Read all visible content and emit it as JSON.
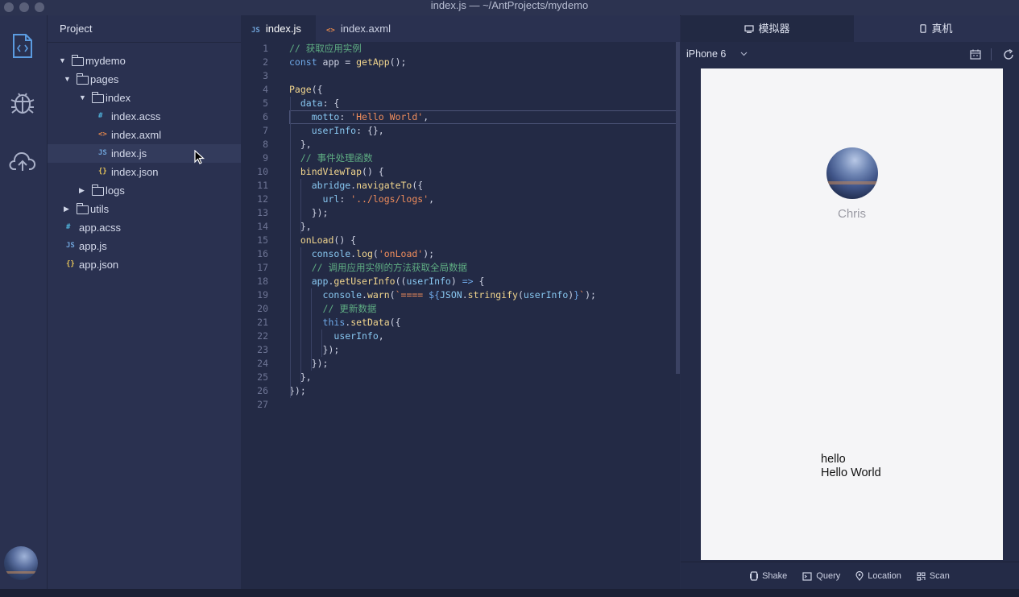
{
  "window": {
    "title": "index.js — ~/AntProjects/mydemo"
  },
  "activity_bar": {
    "icons": [
      "code-file-icon",
      "bug-icon",
      "cloud-upload-icon"
    ]
  },
  "sidebar": {
    "header": "Project",
    "tree": [
      {
        "label": "mydemo",
        "type": "folder",
        "expanded": true,
        "depth": 0
      },
      {
        "label": "pages",
        "type": "folder",
        "expanded": true,
        "depth": 1
      },
      {
        "label": "index",
        "type": "folder",
        "expanded": true,
        "depth": 2
      },
      {
        "label": "index.acss",
        "type": "acss",
        "depth": 3
      },
      {
        "label": "index.axml",
        "type": "axml",
        "depth": 3
      },
      {
        "label": "index.js",
        "type": "js",
        "depth": 3,
        "selected": true
      },
      {
        "label": "index.json",
        "type": "json",
        "depth": 3
      },
      {
        "label": "logs",
        "type": "folder",
        "expanded": false,
        "depth": 2
      },
      {
        "label": "utils",
        "type": "folder",
        "expanded": false,
        "depth": 1
      },
      {
        "label": "app.acss",
        "type": "acss",
        "depth": 1
      },
      {
        "label": "app.js",
        "type": "js",
        "depth": 1
      },
      {
        "label": "app.json",
        "type": "json",
        "depth": 1
      }
    ],
    "file_icon_glyphs": {
      "acss": "#",
      "axml": "<>",
      "js": "JS",
      "json": "{}"
    },
    "file_icon_colors": {
      "acss": "#4fb0d8",
      "axml": "#e4884d",
      "js": "#6fa3d9",
      "json": "#e6c45a"
    }
  },
  "editor": {
    "tabs": [
      {
        "label": "index.js",
        "icon": "JS",
        "active": true
      },
      {
        "label": "index.axml",
        "icon": "<>",
        "active": false
      }
    ],
    "current_line": 6,
    "lines": [
      [
        [
          "cm",
          "// 获取应用实例"
        ]
      ],
      [
        [
          "kw",
          "const "
        ],
        [
          "pn",
          "app = "
        ],
        [
          "fn",
          "getApp"
        ],
        [
          "pn",
          "();"
        ]
      ],
      [],
      [
        [
          "fn",
          "Page"
        ],
        [
          "pn",
          "({"
        ]
      ],
      [
        [
          "pn",
          "  "
        ],
        [
          "prop",
          "data"
        ],
        [
          "pn",
          ": {"
        ]
      ],
      [
        [
          "pn",
          "    "
        ],
        [
          "prop",
          "motto"
        ],
        [
          "pn",
          ": "
        ],
        [
          "str",
          "'Hello World'"
        ],
        [
          "pn",
          ","
        ]
      ],
      [
        [
          "pn",
          "    "
        ],
        [
          "prop",
          "userInfo"
        ],
        [
          "pn",
          ": {},"
        ]
      ],
      [
        [
          "pn",
          "  },"
        ]
      ],
      [
        [
          "pn",
          "  "
        ],
        [
          "cm",
          "// 事件处理函数"
        ]
      ],
      [
        [
          "pn",
          "  "
        ],
        [
          "fn",
          "bindViewTap"
        ],
        [
          "pn",
          "() {"
        ]
      ],
      [
        [
          "pn",
          "    "
        ],
        [
          "prop",
          "abridge"
        ],
        [
          "pn",
          "."
        ],
        [
          "fn",
          "navigateTo"
        ],
        [
          "pn",
          "({"
        ]
      ],
      [
        [
          "pn",
          "      "
        ],
        [
          "prop",
          "url"
        ],
        [
          "pn",
          ": "
        ],
        [
          "str",
          "'../logs/logs'"
        ],
        [
          "pn",
          ","
        ]
      ],
      [
        [
          "pn",
          "    });"
        ]
      ],
      [
        [
          "pn",
          "  },"
        ]
      ],
      [
        [
          "pn",
          "  "
        ],
        [
          "fn",
          "onLoad"
        ],
        [
          "pn",
          "() {"
        ]
      ],
      [
        [
          "pn",
          "    "
        ],
        [
          "prop",
          "console"
        ],
        [
          "pn",
          "."
        ],
        [
          "fn",
          "log"
        ],
        [
          "pn",
          "("
        ],
        [
          "str",
          "'onLoad'"
        ],
        [
          "pn",
          ");"
        ]
      ],
      [
        [
          "pn",
          "    "
        ],
        [
          "cm",
          "// 调用应用实例的方法获取全局数据"
        ]
      ],
      [
        [
          "pn",
          "    "
        ],
        [
          "prop",
          "app"
        ],
        [
          "pn",
          "."
        ],
        [
          "fn",
          "getUserInfo"
        ],
        [
          "pn",
          "(("
        ],
        [
          "prop",
          "userInfo"
        ],
        [
          "pn",
          ") "
        ],
        [
          "kw",
          "=>"
        ],
        [
          "pn",
          " {"
        ]
      ],
      [
        [
          "pn",
          "      "
        ],
        [
          "prop",
          "console"
        ],
        [
          "pn",
          "."
        ],
        [
          "fn",
          "warn"
        ],
        [
          "pn",
          "("
        ],
        [
          "str",
          "`==== "
        ],
        [
          "kw",
          "${"
        ],
        [
          "prop",
          "JSON"
        ],
        [
          "pn",
          "."
        ],
        [
          "fn",
          "stringify"
        ],
        [
          "pn",
          "("
        ],
        [
          "prop",
          "userInfo"
        ],
        [
          "pn",
          ")"
        ],
        [
          "kw",
          "}"
        ],
        [
          "str",
          "`"
        ],
        [
          "pn",
          ");"
        ]
      ],
      [
        [
          "pn",
          "      "
        ],
        [
          "cm",
          "// 更新数据"
        ]
      ],
      [
        [
          "pn",
          "      "
        ],
        [
          "kw",
          "this"
        ],
        [
          "pn",
          "."
        ],
        [
          "fn",
          "setData"
        ],
        [
          "pn",
          "({"
        ]
      ],
      [
        [
          "pn",
          "        "
        ],
        [
          "prop",
          "userInfo"
        ],
        [
          "pn",
          ","
        ]
      ],
      [
        [
          "pn",
          "      });"
        ]
      ],
      [
        [
          "pn",
          "    });"
        ]
      ],
      [
        [
          "pn",
          "  },"
        ]
      ],
      [
        [
          "pn",
          "});"
        ]
      ],
      []
    ]
  },
  "preview": {
    "tabs": [
      {
        "label": "模拟器",
        "icon": "monitor-icon",
        "active": true
      },
      {
        "label": "真机",
        "icon": "phone-icon",
        "active": false
      }
    ],
    "device": "iPhone 6",
    "phone": {
      "name": "Chris",
      "text_hello": "hello",
      "text_motto": "Hello World"
    },
    "footer": [
      {
        "label": "Shake",
        "icon": "shake-icon"
      },
      {
        "label": "Query",
        "icon": "query-icon"
      },
      {
        "label": "Location",
        "icon": "location-icon"
      },
      {
        "label": "Scan",
        "icon": "scan-icon"
      }
    ]
  }
}
